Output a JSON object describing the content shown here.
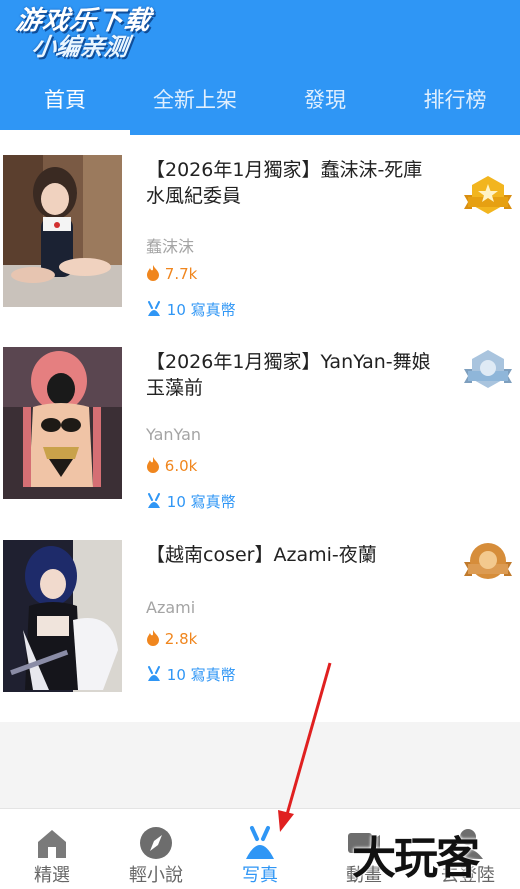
{
  "watermark": {
    "line1": "游戏乐下载",
    "line2": "小编亲测"
  },
  "tabs": [
    {
      "label": "首頁",
      "active": true
    },
    {
      "label": "全新上架",
      "active": false
    },
    {
      "label": "發現",
      "active": false
    },
    {
      "label": "排行榜",
      "active": false
    }
  ],
  "items": [
    {
      "title": "【2026年1月獨家】蠢沫沫-死庫水風紀委員",
      "author": "蠢沫沫",
      "views": "7.7k",
      "price": "10 寫真幣",
      "medal": "gold-medal-icon"
    },
    {
      "title": "【2026年1月獨家】YanYan-舞娘玉藻前",
      "author": "YanYan",
      "views": "6.0k",
      "price": "10 寫真幣",
      "medal": "silver-medal-icon"
    },
    {
      "title": "【越南coser】Azami-夜蘭",
      "author": "Azami",
      "views": "2.8k",
      "price": "10 寫真幣",
      "medal": "bronze-medal-icon"
    }
  ],
  "bottom_nav": [
    {
      "label": "精選",
      "icon": "home-icon",
      "active": false
    },
    {
      "label": "輕小說",
      "icon": "compass-icon",
      "active": false
    },
    {
      "label": "写真",
      "icon": "bunny-icon",
      "active": true
    },
    {
      "label": "動畫",
      "icon": "video-icon",
      "active": false
    },
    {
      "label": "去登陸",
      "icon": "user-icon",
      "active": false
    }
  ],
  "overlay_logo": "大玩客",
  "colors": {
    "brand": "#2f96f5",
    "views": "#f0861e",
    "gold": "#f2b51f",
    "silver": "#8fb6d9",
    "bronze": "#d68d3a"
  }
}
